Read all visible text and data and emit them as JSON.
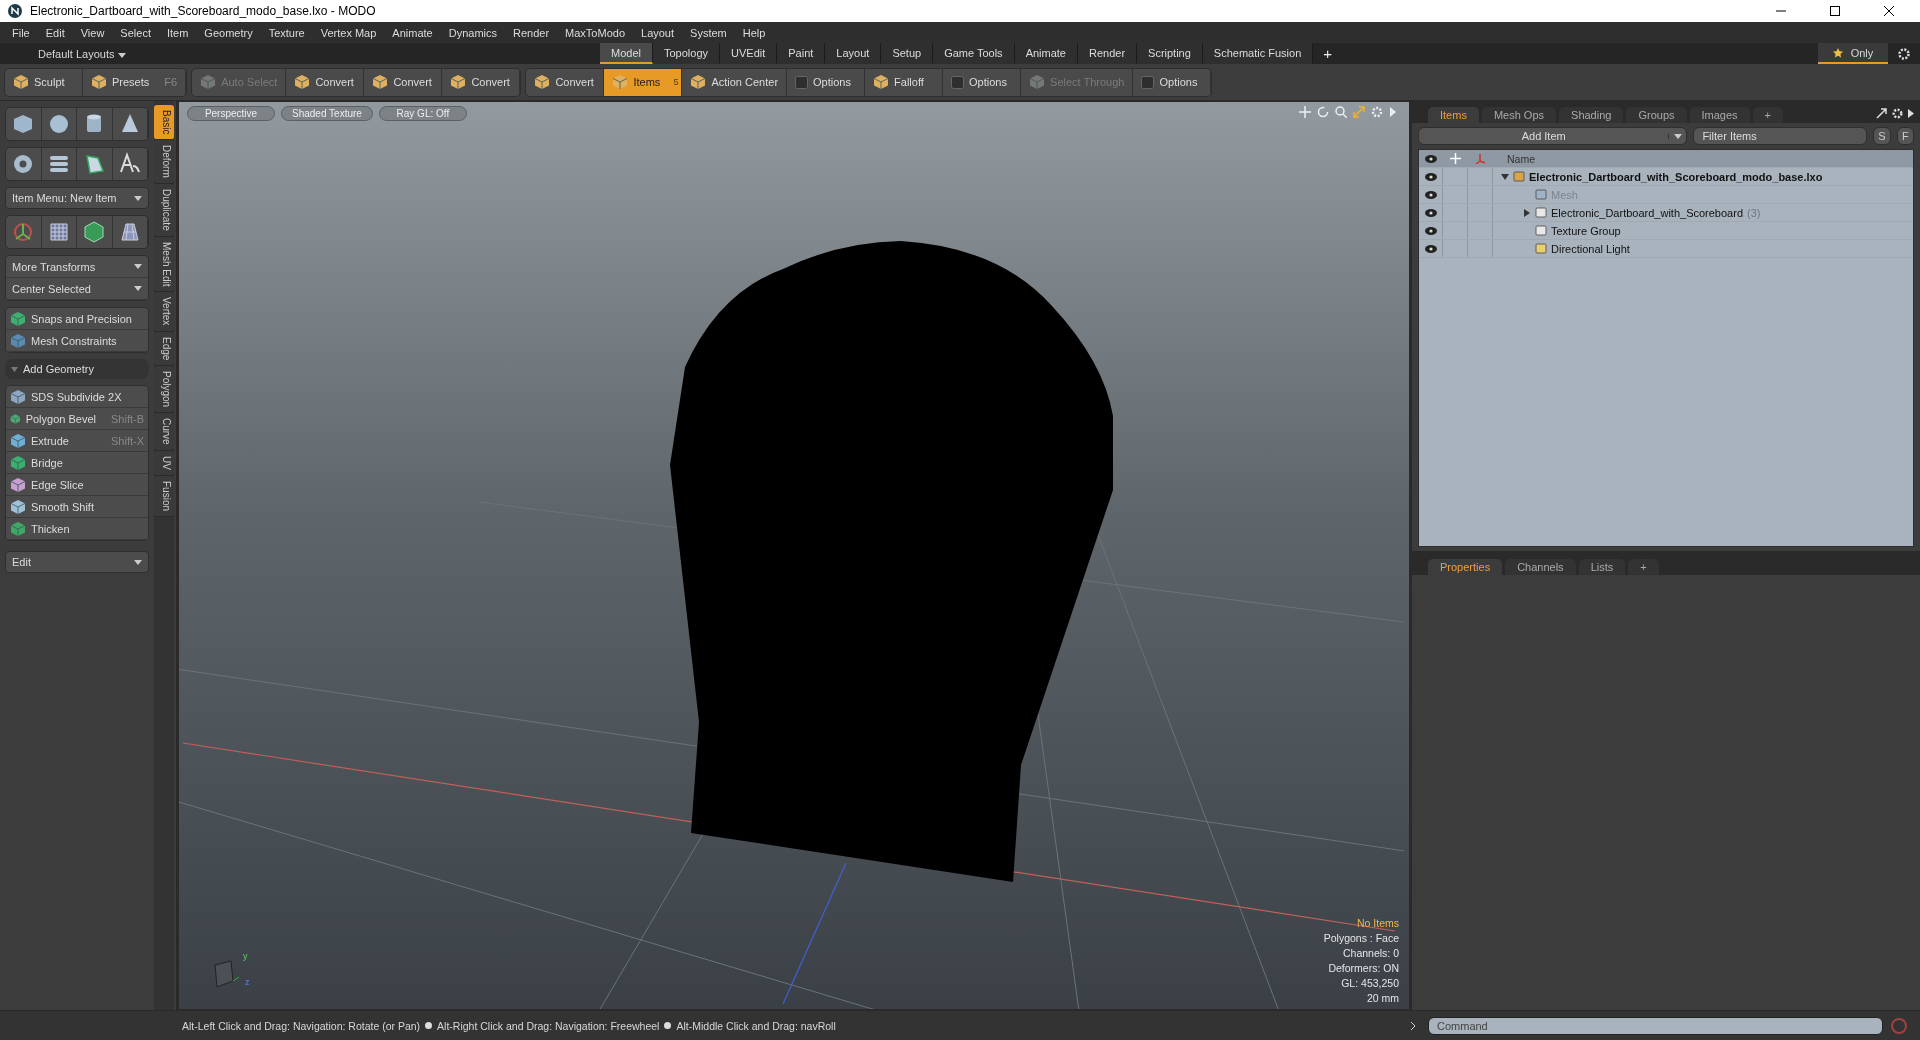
{
  "window": {
    "title": "Electronic_Dartboard_with_Scoreboard_modo_base.lxo - MODO"
  },
  "menu": [
    "File",
    "Edit",
    "View",
    "Select",
    "Item",
    "Geometry",
    "Texture",
    "Vertex Map",
    "Animate",
    "Dynamics",
    "Render",
    "MaxToModo",
    "Layout",
    "System",
    "Help"
  ],
  "layout_bar": {
    "layout_menu": "Default Layouts",
    "tabs": [
      {
        "label": "Model",
        "selected": true
      },
      {
        "label": "Topology",
        "selected": false
      },
      {
        "label": "UVEdit",
        "selected": false
      },
      {
        "label": "Paint",
        "selected": false
      },
      {
        "label": "Layout",
        "selected": false
      },
      {
        "label": "Setup",
        "selected": false
      },
      {
        "label": "Game Tools",
        "selected": false
      },
      {
        "label": "Animate",
        "selected": false
      },
      {
        "label": "Render",
        "selected": false
      },
      {
        "label": "Scripting",
        "selected": false
      },
      {
        "label": "Schematic Fusion",
        "selected": false
      }
    ],
    "add_tab": "+",
    "only": "Only"
  },
  "toolbar": [
    {
      "items": [
        {
          "kind": "button",
          "label": "Sculpt"
        },
        {
          "kind": "button",
          "label": "Presets",
          "shortcut": "F6"
        }
      ]
    },
    {
      "items": [
        {
          "kind": "button",
          "label": "Auto Select",
          "disabled": true
        },
        {
          "kind": "button",
          "label": "Convert"
        },
        {
          "kind": "button",
          "label": "Convert"
        },
        {
          "kind": "button",
          "label": "Convert"
        }
      ]
    },
    {
      "items": [
        {
          "kind": "button",
          "label": "Convert"
        },
        {
          "kind": "button",
          "label": "Items",
          "selected": true,
          "badge": "5"
        },
        {
          "kind": "button",
          "label": "Action Center"
        },
        {
          "kind": "check",
          "label": "Options"
        },
        {
          "kind": "button",
          "label": "Falloff"
        },
        {
          "kind": "check",
          "label": "Options"
        },
        {
          "kind": "button",
          "label": "Select Through",
          "disabled": true
        },
        {
          "kind": "check",
          "label": "Options"
        }
      ]
    }
  ],
  "left_panel": {
    "item_menu": "Item Menu: New Item",
    "transform_menus": [
      "More Transforms",
      "Center Selected"
    ],
    "constraint_tools": [
      "Snaps and Precision",
      "Mesh Constraints"
    ],
    "section": {
      "label": "Add Geometry",
      "expanded": true
    },
    "tools": [
      {
        "label": "SDS Subdivide 2X"
      },
      {
        "label": "Polygon Bevel",
        "shortcut": "Shift-B"
      },
      {
        "label": "Extrude",
        "shortcut": "Shift-X"
      },
      {
        "label": "Bridge"
      },
      {
        "label": "Edge Slice"
      },
      {
        "label": "Smooth Shift"
      },
      {
        "label": "Thicken"
      }
    ],
    "edit_menu": "Edit",
    "vertical_tabs": [
      {
        "label": "Basic",
        "selected": true
      },
      {
        "label": "Deform",
        "selected": false
      },
      {
        "label": "Duplicate",
        "selected": false
      },
      {
        "label": "Mesh Edit",
        "selected": false
      },
      {
        "label": "Vertex",
        "selected": false
      },
      {
        "label": "Edge",
        "selected": false
      },
      {
        "label": "Polygon",
        "selected": false
      },
      {
        "label": "Curve",
        "selected": false
      },
      {
        "label": "UV",
        "selected": false
      },
      {
        "label": "Fusion",
        "selected": false
      }
    ]
  },
  "viewport": {
    "buttons": [
      "Perspective",
      "Shaded Texture",
      "Ray GL: Off"
    ],
    "info": [
      "No Items",
      "Polygons : Face",
      "Channels: 0",
      "Deformers: ON",
      "GL: 453,250",
      "20 mm"
    ],
    "gizmo_labels": [
      "y",
      "z"
    ]
  },
  "items_panel": {
    "tabs": [
      {
        "label": "Items",
        "selected": true
      },
      {
        "label": "Mesh Ops",
        "selected": false
      },
      {
        "label": "Shading",
        "selected": false
      },
      {
        "label": "Groups",
        "selected": false
      },
      {
        "label": "Images",
        "selected": false
      }
    ],
    "add_tab": "+",
    "add_item": "Add Item",
    "filter": {
      "placeholder": "Filter Items"
    },
    "filter_buttons": [
      "S",
      "F"
    ],
    "column": "Name",
    "tree": [
      {
        "label": "Electronic_Dartboard_with_Scoreboard_modo_base.lxo",
        "kind": "scene",
        "expanded": true,
        "children": [
          {
            "label": "Mesh",
            "kind": "mesh",
            "disabled": true
          },
          {
            "label": "Electronic_Dartboard_with_Scoreboard",
            "kind": "group",
            "count": "(3)",
            "expanded": false
          },
          {
            "label": "Texture Group",
            "kind": "group"
          },
          {
            "label": "Directional Light",
            "kind": "light"
          }
        ]
      }
    ]
  },
  "properties_panel": {
    "tabs": [
      {
        "label": "Properties",
        "selected": true
      },
      {
        "label": "Channels",
        "selected": false
      },
      {
        "label": "Lists",
        "selected": false
      }
    ],
    "add_tab": "+"
  },
  "status_bar": {
    "hints": [
      "Alt-Left Click and Drag: Navigation: Rotate (or Pan)",
      "Alt-Right Click and Drag: Navigation: Freewheel",
      "Alt-Middle Click and Drag: navRoll"
    ],
    "command": {
      "placeholder": "Command"
    }
  }
}
